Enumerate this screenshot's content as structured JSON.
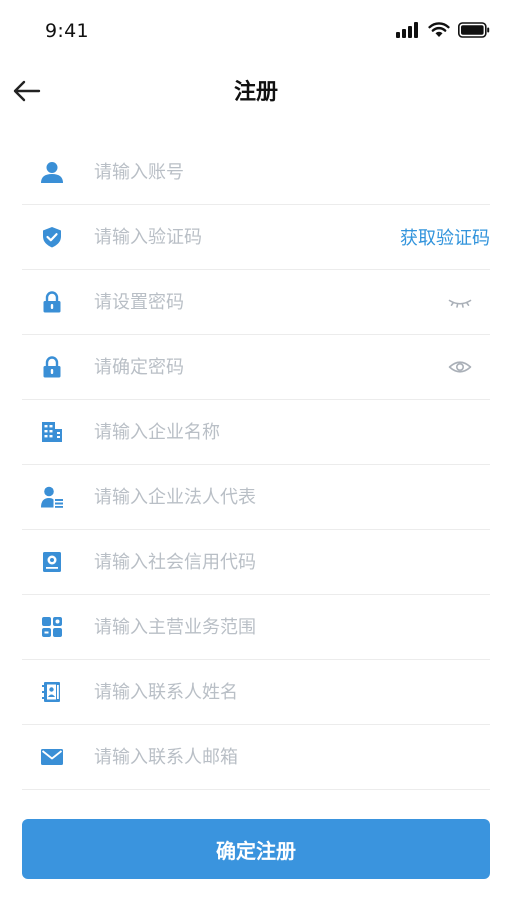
{
  "status_bar": {
    "time": "9:41"
  },
  "header": {
    "title": "注册"
  },
  "form": {
    "account": {
      "placeholder": "请输入账号",
      "value": ""
    },
    "verify_code": {
      "placeholder": "请输入验证码",
      "value": "",
      "get_code_label": "获取验证码"
    },
    "password": {
      "placeholder": "请设置密码",
      "value": ""
    },
    "confirm_password": {
      "placeholder": "请确定密码",
      "value": ""
    },
    "company_name": {
      "placeholder": "请输入企业名称",
      "value": ""
    },
    "legal_representative": {
      "placeholder": "请输入企业法人代表",
      "value": ""
    },
    "credit_code": {
      "placeholder": "请输入社会信用代码",
      "value": ""
    },
    "business_scope": {
      "placeholder": "请输入主营业务范围",
      "value": ""
    },
    "contact_name": {
      "placeholder": "请输入联系人姓名",
      "value": ""
    },
    "contact_email": {
      "placeholder": "请输入联系人邮箱",
      "value": ""
    }
  },
  "submit": {
    "label": "确定注册"
  },
  "icons": {
    "account": "user-icon",
    "verify_code": "shield-check-icon",
    "password": "lock-icon",
    "confirm_password": "lock-icon",
    "company_name": "building-icon",
    "legal_representative": "person-card-icon",
    "credit_code": "certificate-icon",
    "business_scope": "grid-icon",
    "contact_name": "contact-book-icon",
    "contact_email": "mail-icon",
    "password_visibility": "eye-closed-icon",
    "confirm_password_visibility": "eye-open-icon"
  },
  "colors": {
    "accent": "#3a94de",
    "icon": "#3a8fd6",
    "placeholder": "#b9bfc6",
    "divider": "#ececec"
  }
}
